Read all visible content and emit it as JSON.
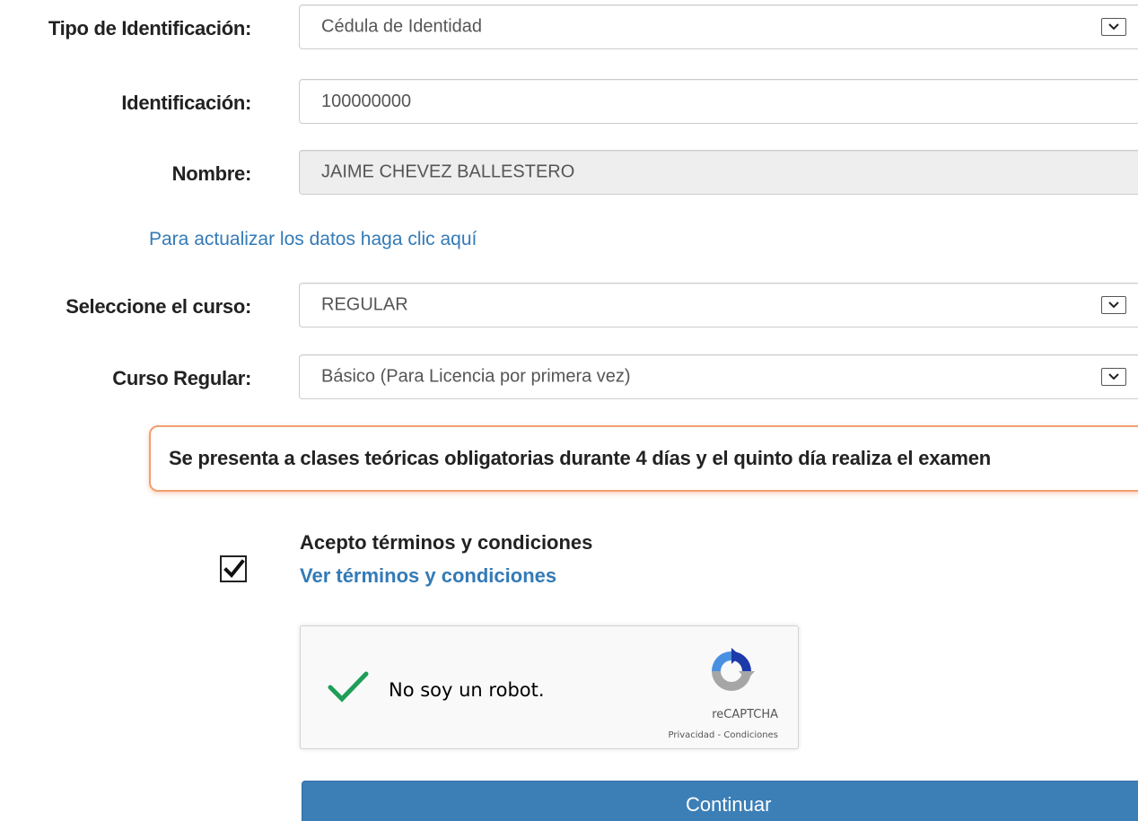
{
  "form": {
    "id_type": {
      "label": "Tipo de Identificación:",
      "selected": "Cédula de Identidad"
    },
    "id_number": {
      "label": "Identificación:",
      "value": "100000000"
    },
    "name": {
      "label": "Nombre:",
      "value": "JAIME CHEVEZ BALLESTERO"
    },
    "update_link": "Para actualizar los datos haga clic aquí",
    "course": {
      "label": "Seleccione el curso:",
      "selected": "REGULAR"
    },
    "regular_course": {
      "label": "Curso Regular:",
      "selected": "Básico (Para Licencia por primera vez)"
    },
    "notice": "Se presenta a clases teóricas obligatorias durante 4 días y el quinto día realiza el examen",
    "terms": {
      "label": "Acepto términos y condiciones",
      "link": "Ver términos y condiciones",
      "checked": true
    },
    "recaptcha": {
      "text": "No soy un robot.",
      "brand": "reCAPTCHA",
      "privacy": "Privacidad - Condiciones",
      "verified": true
    },
    "continue_label": "Continuar"
  },
  "colors": {
    "link": "#337ab7",
    "button": "#3c7fb6",
    "notice_border": "#f0a070",
    "check_green": "#1e9e58"
  }
}
